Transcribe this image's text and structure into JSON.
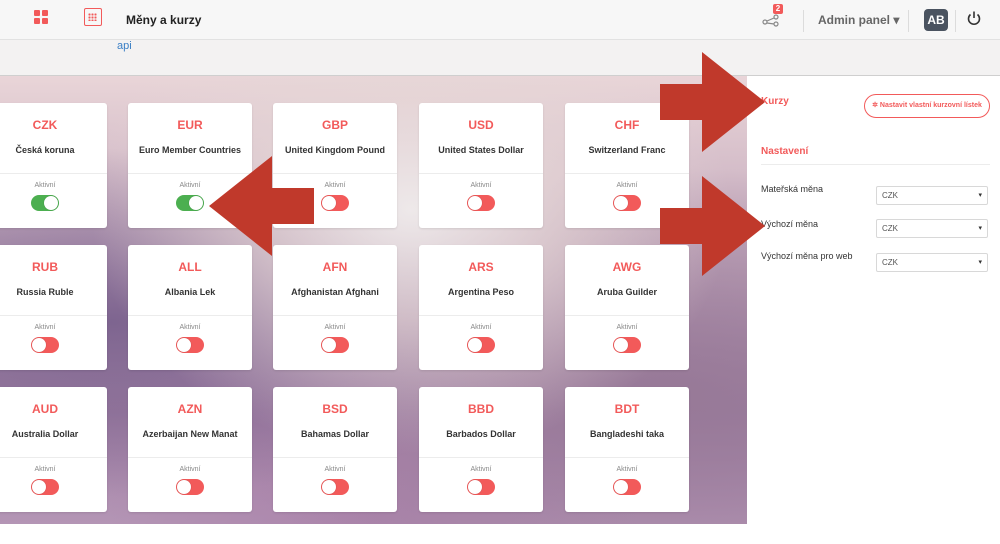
{
  "header": {
    "title": "Měny a kurzy",
    "notification_count": "2",
    "admin_label": "Admin panel ▾",
    "avatar_initials": "AB",
    "accent": "#f25a5a"
  },
  "subnav": {
    "link": "api"
  },
  "cards": [
    {
      "code": "CZK",
      "name": "Česká koruna",
      "status": "Aktivní",
      "active": true
    },
    {
      "code": "EUR",
      "name": "Euro Member Countries",
      "status": "Aktivní",
      "active": true
    },
    {
      "code": "GBP",
      "name": "United Kingdom Pound",
      "status": "Aktivní",
      "active": false
    },
    {
      "code": "USD",
      "name": "United States Dollar",
      "status": "Aktivní",
      "active": false
    },
    {
      "code": "CHF",
      "name": "Switzerland Franc",
      "status": "Aktivní",
      "active": false
    },
    {
      "code": "RUB",
      "name": "Russia Ruble",
      "status": "Aktivní",
      "active": false
    },
    {
      "code": "ALL",
      "name": "Albania Lek",
      "status": "Aktivní",
      "active": false
    },
    {
      "code": "AFN",
      "name": "Afghanistan Afghani",
      "status": "Aktivní",
      "active": false
    },
    {
      "code": "ARS",
      "name": "Argentina Peso",
      "status": "Aktivní",
      "active": false
    },
    {
      "code": "AWG",
      "name": "Aruba Guilder",
      "status": "Aktivní",
      "active": false
    },
    {
      "code": "AUD",
      "name": "Australia Dollar",
      "status": "Aktivní",
      "active": false
    },
    {
      "code": "AZN",
      "name": "Azerbaijan New Manat",
      "status": "Aktivní",
      "active": false
    },
    {
      "code": "BSD",
      "name": "Bahamas Dollar",
      "status": "Aktivní",
      "active": false
    },
    {
      "code": "BBD",
      "name": "Barbados Dollar",
      "status": "Aktivní",
      "active": false
    },
    {
      "code": "BDT",
      "name": "Bangladeshi taka",
      "status": "Aktivní",
      "active": false
    }
  ],
  "sidebar": {
    "kurzy": "Kurzy",
    "set_button": "✲ Nastavit vlastní kurzovní lístek",
    "nastaveni": "Nastavení",
    "fields": [
      {
        "label": "Mateřská měna",
        "value": "CZK"
      },
      {
        "label": "Výchozí měna",
        "value": "CZK"
      },
      {
        "label": "Výchozí měna pro web",
        "value": "CZK"
      }
    ]
  }
}
